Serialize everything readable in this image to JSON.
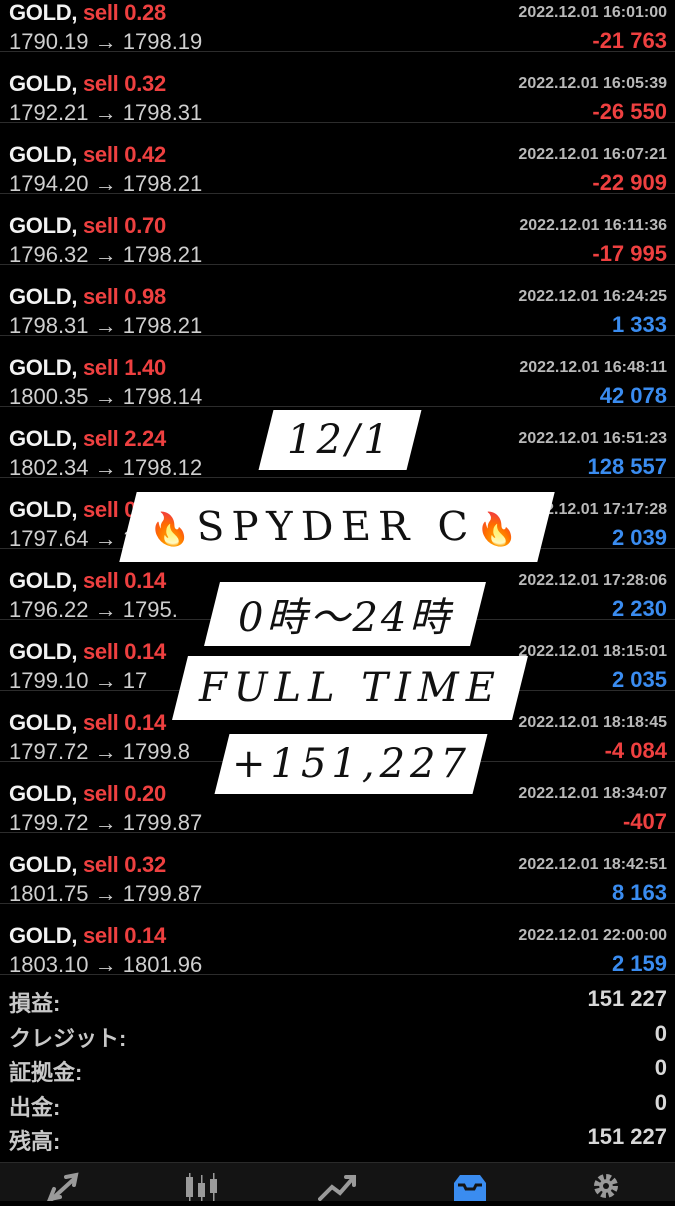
{
  "trades": [
    {
      "symbol": "GOLD,",
      "side": "sell 0.28",
      "price": "1790.19 → 1798.19",
      "time": "2022.12.01 16:01:00",
      "profit": "-21 763",
      "dir": "neg"
    },
    {
      "symbol": "GOLD,",
      "side": "sell 0.32",
      "price": "1792.21 → 1798.31",
      "time": "2022.12.01 16:05:39",
      "profit": "-26 550",
      "dir": "neg"
    },
    {
      "symbol": "GOLD,",
      "side": "sell 0.42",
      "price": "1794.20 → 1798.21",
      "time": "2022.12.01 16:07:21",
      "profit": "-22 909",
      "dir": "neg"
    },
    {
      "symbol": "GOLD,",
      "side": "sell 0.70",
      "price": "1796.32 → 1798.21",
      "time": "2022.12.01 16:11:36",
      "profit": "-17 995",
      "dir": "neg"
    },
    {
      "symbol": "GOLD,",
      "side": "sell 0.98",
      "price": "1798.31 → 1798.21",
      "time": "2022.12.01 16:24:25",
      "profit": "1 333",
      "dir": "pos"
    },
    {
      "symbol": "GOLD,",
      "side": "sell 1.40",
      "price": "1800.35 → 1798.14",
      "time": "2022.12.01 16:48:11",
      "profit": "42 078",
      "dir": "pos"
    },
    {
      "symbol": "GOLD,",
      "side": "sell 2.24",
      "price": "1802.34 → 1798.12",
      "time": "2022.12.01 16:51:23",
      "profit": "128 557",
      "dir": "pos"
    },
    {
      "symbol": "GOLD,",
      "side": "sell 0.14",
      "price": "1797.64 → 1798.12",
      "time": "2022.12.01 17:17:28",
      "profit": "2 039",
      "dir": "pos"
    },
    {
      "symbol": "GOLD,",
      "side": "sell 0.14",
      "price": "1796.22 → 1795.",
      "time": "2022.12.01 17:28:06",
      "profit": "2 230",
      "dir": "pos"
    },
    {
      "symbol": "GOLD,",
      "side": "sell 0.14",
      "price": "1799.10 → 17",
      "time": "2022.12.01 18:15:01",
      "profit": "2 035",
      "dir": "pos"
    },
    {
      "symbol": "GOLD,",
      "side": "sell 0.14",
      "price": "1797.72 → 1799.8",
      "time": "2022.12.01 18:18:45",
      "profit": "-4 084",
      "dir": "neg"
    },
    {
      "symbol": "GOLD,",
      "side": "sell 0.20",
      "price": "1799.72 → 1799.87",
      "time": "2022.12.01 18:34:07",
      "profit": "-407",
      "dir": "neg"
    },
    {
      "symbol": "GOLD,",
      "side": "sell 0.32",
      "price": "1801.75 → 1799.87",
      "time": "2022.12.01 18:42:51",
      "profit": "8 163",
      "dir": "pos"
    },
    {
      "symbol": "GOLD,",
      "side": "sell 0.14",
      "price": "1803.10 → 1801.96",
      "time": "2022.12.01 22:00:00",
      "profit": "2 159",
      "dir": "pos"
    }
  ],
  "summary": [
    {
      "label": "損益:",
      "value": "151 227"
    },
    {
      "label": "クレジット:",
      "value": "0"
    },
    {
      "label": "証拠金:",
      "value": "0"
    },
    {
      "label": "出金:",
      "value": "0"
    },
    {
      "label": "残高:",
      "value": "151 227"
    }
  ],
  "overlay": {
    "date": "12/1",
    "fire_icon": "🔥",
    "name": "SPYDER C",
    "hours": "0時～24時",
    "fulltime": "FULL TIME",
    "total": "+151,227"
  },
  "tabs": [
    {
      "name": "quotes-tab",
      "icon": "arrows-icon"
    },
    {
      "name": "chart-tab",
      "icon": "candlestick-icon"
    },
    {
      "name": "trade-tab",
      "icon": "trend-icon"
    },
    {
      "name": "history-tab",
      "icon": "inbox-icon",
      "active": true
    },
    {
      "name": "settings-tab",
      "icon": "gear-icon"
    }
  ],
  "colors": {
    "loss": "#ee4040",
    "profit": "#3a8cf0",
    "active_tab": "#3a8cf0"
  }
}
